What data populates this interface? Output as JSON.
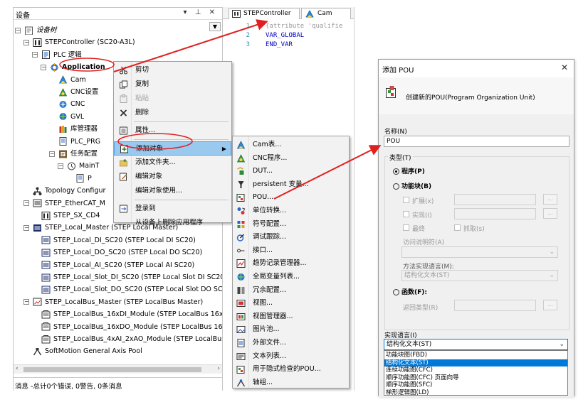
{
  "devices_panel": {
    "title": "设备",
    "pin_glyph": "▾ ⊥ ✕",
    "tree": [
      {
        "label": "设备树",
        "indent": 0,
        "exp": "⊟",
        "icon": "doc"
      },
      {
        "label": "STEPController (SC20-A3L)",
        "indent": 1,
        "exp": "⊟",
        "icon": "ctrl"
      },
      {
        "label": "PLC 逻辑",
        "indent": 2,
        "exp": "⊟",
        "icon": "plc"
      },
      {
        "label": "Application",
        "indent": 3,
        "exp": "⊟",
        "icon": "app"
      },
      {
        "label": "Cam",
        "indent": 4,
        "exp": "",
        "icon": "cam"
      },
      {
        "label": "CNC设置",
        "indent": 4,
        "exp": "",
        "icon": "cnc"
      },
      {
        "label": "CNC",
        "indent": 4,
        "exp": "",
        "icon": "cnc2"
      },
      {
        "label": "GVL",
        "indent": 4,
        "exp": "",
        "icon": "gvl"
      },
      {
        "label": "库管理器",
        "indent": 4,
        "exp": "",
        "icon": "lib"
      },
      {
        "label": "PLC_PRG",
        "indent": 4,
        "exp": "",
        "icon": "prg"
      },
      {
        "label": "任务配置",
        "indent": 4,
        "exp": "⊟",
        "icon": "task"
      },
      {
        "label": "MainT",
        "indent": 5,
        "exp": "⊟",
        "icon": "maint"
      },
      {
        "label": "P",
        "indent": 6,
        "exp": "",
        "icon": "prg"
      },
      {
        "label": "Topology Configur",
        "indent": 1,
        "exp": "",
        "icon": "topo"
      },
      {
        "label": "STEP_EtherCAT_M",
        "indent": 1,
        "exp": "⊟",
        "icon": "ecat"
      },
      {
        "label": "STEP_SX_CD4",
        "indent": 2,
        "exp": "",
        "icon": "sx"
      },
      {
        "label": "STEP_Local_Master (STEP Local Master)",
        "indent": 1,
        "exp": "⊟",
        "icon": "lm"
      },
      {
        "label": "STEP_Local_DI_SC20 (STEP Local DI SC20)",
        "indent": 2,
        "exp": "",
        "icon": "io"
      },
      {
        "label": "STEP_Local_DO_SC20 (STEP Local DO SC20)",
        "indent": 2,
        "exp": "",
        "icon": "io"
      },
      {
        "label": "STEP_Local_AI_SC20 (STEP Local AI SC20)",
        "indent": 2,
        "exp": "",
        "icon": "io"
      },
      {
        "label": "STEP_Local_Slot_DI_SC20 (STEP Local Slot DI SC20",
        "indent": 2,
        "exp": "",
        "icon": "io"
      },
      {
        "label": "STEP_Local_Slot_DO_SC20 (STEP Local Slot DO SC",
        "indent": 2,
        "exp": "",
        "icon": "io"
      },
      {
        "label": "STEP_LocalBus_Master (STEP LocalBus Master)",
        "indent": 1,
        "exp": "⊟",
        "icon": "lb"
      },
      {
        "label": "STEP_LocalBus_16xDI_Module (STEP LocalBus 16xD",
        "indent": 2,
        "exp": "",
        "icon": "mod"
      },
      {
        "label": "STEP_LocalBus_16xDO_Module (STEP LocalBus 16x",
        "indent": 2,
        "exp": "",
        "icon": "mod"
      },
      {
        "label": "STEP_LocalBus_4xAI_2xAO_Module (STEP LocalBus",
        "indent": 2,
        "exp": "",
        "icon": "mod"
      },
      {
        "label": "SoftMotion General Axis Pool",
        "indent": 1,
        "exp": "",
        "icon": "axis"
      }
    ],
    "status": "消息 -总计0个错误, 0警告, 0条消息"
  },
  "editor": {
    "tabs": [
      "STEPController",
      "Cam"
    ],
    "lines": [
      {
        "n": "1",
        "text": "{attribute 'qualifie"
      },
      {
        "n": "2",
        "text": "VAR_GLOBAL"
      },
      {
        "n": "3",
        "text": "END_VAR"
      }
    ]
  },
  "context_menu": {
    "items": [
      {
        "label": "剪切",
        "icon": "cut",
        "disabled": false
      },
      {
        "label": "复制",
        "icon": "copy",
        "disabled": false
      },
      {
        "label": "粘贴",
        "icon": "paste",
        "disabled": true
      },
      {
        "label": "删除",
        "icon": "del",
        "disabled": false
      },
      {
        "label": "属性...",
        "icon": "prop",
        "disabled": false,
        "sep_before": true
      },
      {
        "label": "添加对象",
        "icon": "add",
        "disabled": false,
        "sep_before": true,
        "submenu": true,
        "highlight": true
      },
      {
        "label": "添加文件夹...",
        "icon": "folder",
        "disabled": false
      },
      {
        "label": "编辑对象",
        "icon": "edit",
        "disabled": false
      },
      {
        "label": "编辑对象使用...",
        "icon": "",
        "disabled": false
      },
      {
        "label": "登录到",
        "icon": "login",
        "disabled": false,
        "sep_before": true
      },
      {
        "label": "从设备上删除应用程序",
        "icon": "",
        "disabled": false
      }
    ]
  },
  "submenu": {
    "items": [
      {
        "label": "Cam表...",
        "icon": "cam"
      },
      {
        "label": "CNC程序...",
        "icon": "cnc"
      },
      {
        "label": "DUT...",
        "icon": "dut"
      },
      {
        "label": "persistent 变量...",
        "icon": "pers"
      },
      {
        "label": "POU...",
        "icon": "pou"
      },
      {
        "label": "单位转换...",
        "icon": "unit"
      },
      {
        "label": "符号配置...",
        "icon": "sym"
      },
      {
        "label": "调试跟踪...",
        "icon": "trace"
      },
      {
        "label": "接口...",
        "icon": "itf"
      },
      {
        "label": "趋势记录管理器...",
        "icon": "trend"
      },
      {
        "label": "全局变量列表...",
        "icon": "gvl"
      },
      {
        "label": "冗余配置...",
        "icon": "red"
      },
      {
        "label": "视图...",
        "icon": "vis"
      },
      {
        "label": "视图管理器...",
        "icon": "vism"
      },
      {
        "label": "图片池...",
        "icon": "img"
      },
      {
        "label": "外部文件...",
        "icon": "ext"
      },
      {
        "label": "文本列表...",
        "icon": "txt"
      },
      {
        "label": "用于隐式检查的POU...",
        "icon": "pou2"
      },
      {
        "label": "轴组...",
        "icon": "axg"
      }
    ]
  },
  "dialog": {
    "title": "添加 POU",
    "close": "✕",
    "header_text": "创建新的POU(Program Organization Unit)",
    "name_label": "名称(N)",
    "name_value": "POU",
    "type_label": "类型(T)",
    "program_label": "程序(P)",
    "fb_label": "功能块(B)",
    "extends_label": "扩展(x)",
    "implements_label": "实现(I)",
    "final_label": "最终",
    "abstract_label": "抓取(s)",
    "access_label": "访问说明符(A)",
    "method_lang_label": "方法实现语言(M):",
    "method_lang_value": "结构化文本(ST)",
    "function_label": "函数(F):",
    "return_label": "返回类型(R)",
    "impl_lang_label": "实现语言(I)",
    "impl_lang_value": "结构化文本(ST)",
    "ellipsis": "...",
    "lang_options": [
      "功能块图(FBD)",
      "结构化文本(ST)",
      "连续功能图(CFC)",
      "顺序功能图(CFC) 页面向导",
      "顺序功能图(SFC)",
      "梯形逻辑图(LD)"
    ],
    "lang_selected": 1
  },
  "colors": {
    "arrow": "#e02020",
    "highlight": "#99c9ef",
    "select": "#0078d7"
  }
}
